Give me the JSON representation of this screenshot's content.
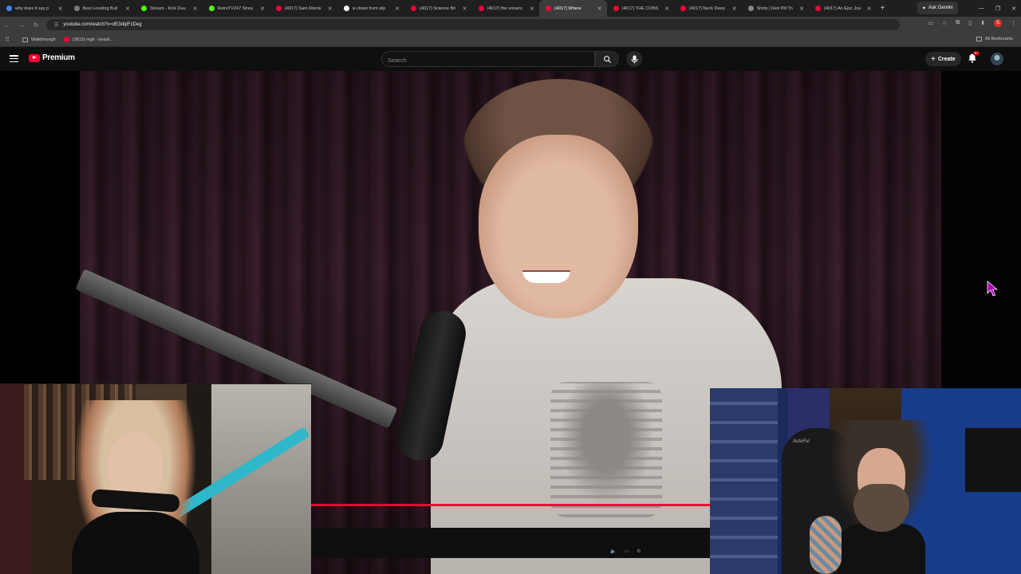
{
  "browser": {
    "tabs": [
      {
        "title": "why does it say p",
        "color": "#4285f4"
      },
      {
        "title": "Best Leveling Buil",
        "color": "#7a7a7a"
      },
      {
        "title": "Stream - Kick Dau",
        "color": "#53fc18"
      },
      {
        "title": "RetroTV247 Strea",
        "color": "#53fc18"
      },
      {
        "title": "(4017) Sam Morris",
        "color": "#ff0033"
      },
      {
        "title": "is clown from slip",
        "color": "#ffffff"
      },
      {
        "title": "(4017) Science Bri",
        "color": "#ff0033"
      },
      {
        "title": "(4017) the univers",
        "color": "#ff0033"
      },
      {
        "title": "(4017) Where",
        "color": "#ff0033",
        "active": true
      },
      {
        "title": "(4017) THE CONS",
        "color": "#ff0033"
      },
      {
        "title": "(4017) Neck Deep",
        "color": "#ff0033"
      },
      {
        "title": "Shirts | Red Pill Th",
        "color": "#888888"
      },
      {
        "title": "(4017) An Epic Jou",
        "color": "#ff0033"
      }
    ],
    "new_tab": "+",
    "ask_gemini": "Ask Gemini",
    "url": "youtube.com/watch?v=dE3dqIFzDeg",
    "bookmarks": [
      {
        "label": "Walkthrough",
        "icon": "folder-icon"
      },
      {
        "label": "(3813) mgk - treadi...",
        "icon": "youtube-icon"
      }
    ],
    "all_bookmarks": "All Bookmarks",
    "profile_initial": "S"
  },
  "youtube": {
    "logo_text": "Premium",
    "search_placeholder": "Search",
    "create_label": "Create",
    "notification_badge": "9+"
  },
  "video": {
    "progress_fraction": 1.0,
    "brand_color": "#ff0033"
  },
  "webcam_right": {
    "chair_label": "AutoFul"
  }
}
